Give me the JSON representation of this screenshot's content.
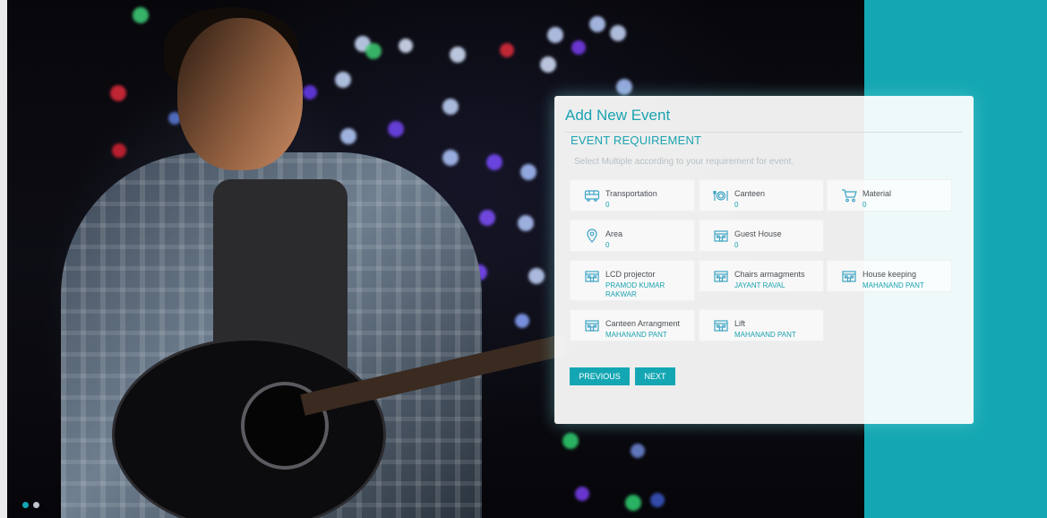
{
  "form": {
    "title": "Add New Event",
    "section_title": "EVENT REQUIREMENT",
    "instruction": "Select Multiple according to your requirement for event."
  },
  "requirements": [
    {
      "label": "Transportation",
      "value": "0",
      "icon": "bus-icon"
    },
    {
      "label": "Canteen",
      "value": "0",
      "icon": "dining-icon"
    },
    {
      "label": "Material",
      "value": "0",
      "icon": "cart-icon"
    },
    {
      "label": "Area",
      "value": "0",
      "icon": "location-pin-icon"
    },
    {
      "label": "Guest House",
      "value": "0",
      "icon": "building-icon"
    },
    {
      "label": "LCD projector",
      "value": "PRAMOD KUMAR RAKWAR",
      "icon": "building-icon"
    },
    {
      "label": "Chairs armagments",
      "value": "JAYANT RAVAL",
      "icon": "building-icon"
    },
    {
      "label": "House keeping",
      "value": "MAHANAND PANT",
      "icon": "building-icon"
    },
    {
      "label": "Canteen Arrangment",
      "value": "MAHANAND PANT",
      "icon": "building-icon"
    },
    {
      "label": "Lift",
      "value": "MAHANAND PANT",
      "icon": "building-icon"
    }
  ],
  "buttons": {
    "previous": "PREVIOUS",
    "next": "NEXT"
  },
  "colors": {
    "accent": "#14a7b3",
    "panel_bg": "#ffffff",
    "label_text": "#4a4f54",
    "muted_text": "#b7bfc4"
  },
  "slider": {
    "total_slides": 2,
    "active_slide": 1
  }
}
